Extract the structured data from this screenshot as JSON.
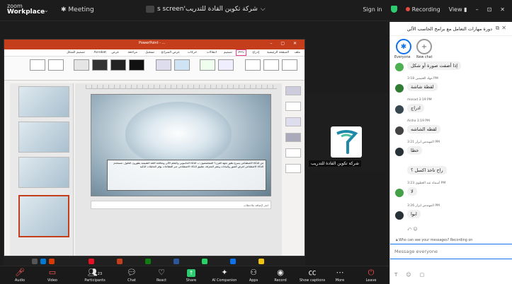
{
  "titlebar": {
    "brand_line1": "zoom",
    "brand_line2": "Workplace",
    "meeting_label": "Meeting",
    "share_title": "شركة تكوين القادة للتدريب's screen",
    "signin": "Sign in",
    "recording": "Recording",
    "view": "View"
  },
  "ppt": {
    "filename": "PowerPoint - ...",
    "tabs": [
      "ملف",
      "الصفحة الرئيسية",
      "إدراج",
      "رسم",
      "تصميم",
      "انتقالات",
      "حركات",
      "عرض الشرائح",
      "تسجيل",
      "مراجعة",
      "عرض",
      "Acrobat",
      "تصميم الشكل"
    ],
    "slide_text": "من الذكاء الاصطناعي يسرع تطور نجهة القرن؟ المتخصصون ب الذكاء الحاسوبي والتعلم الآلي ومعالجة اللغة الطبيعية يطورون الحلول. مستخدم الذكاء الاصطناعي لعرض الصور والبيانات ونشر المعرفة. تطبيق الذكاء الاصطناعي عبر القطاعات يوفر التحليلات الذكية",
    "notes": "انقر لإضافة ملاحظات"
  },
  "participant": {
    "name": "شركة تكوين القادة للتدريب"
  },
  "chat": {
    "title": "دورة مهارات التعامل مع برامج الحاسب الآلي",
    "recipients": [
      "Everyone",
      "New chat"
    ],
    "messages": [
      {
        "sender": "",
        "text": "إذا أضفت صورة أو شكل",
        "avatar_color": "#4caf50"
      },
      {
        "sender": "مهاد العثيمين 3:18 PM",
        "text": "لقطة شاشة",
        "avatar_color": "#2e7d32"
      },
      {
        "sender": "mosad 3:19 PM",
        "text": "ادراج",
        "avatar_color": "#37474f"
      },
      {
        "sender": "Aisha 3:19 PM",
        "text": "لقطه الشاشه",
        "avatar_color": "#424242"
      },
      {
        "sender": "المهندس ابرار 3:21 PM",
        "text": "خطا",
        "avatar_color": "#263238"
      },
      {
        "sender": "",
        "text": "راح تاخذ اكسل ؟",
        "avatar_color": ""
      },
      {
        "sender": "أسماء عبد العطوي 3:23 PM",
        "text": "لا",
        "avatar_color": "#43a047"
      },
      {
        "sender": "المهندس ابرار 3:26 PM",
        "text": "ابوا",
        "avatar_color": "#263238"
      }
    ],
    "who_can_see": "Who can see your messages? Recording on",
    "input_placeholder": "Message everyone"
  },
  "toolbar": {
    "items": [
      "Audio",
      "Video",
      "Participants",
      "Chat",
      "React",
      "Share",
      "AI Companion",
      "Apps",
      "Record",
      "Show captions",
      "More",
      "Leave"
    ],
    "participants_count": "23"
  }
}
